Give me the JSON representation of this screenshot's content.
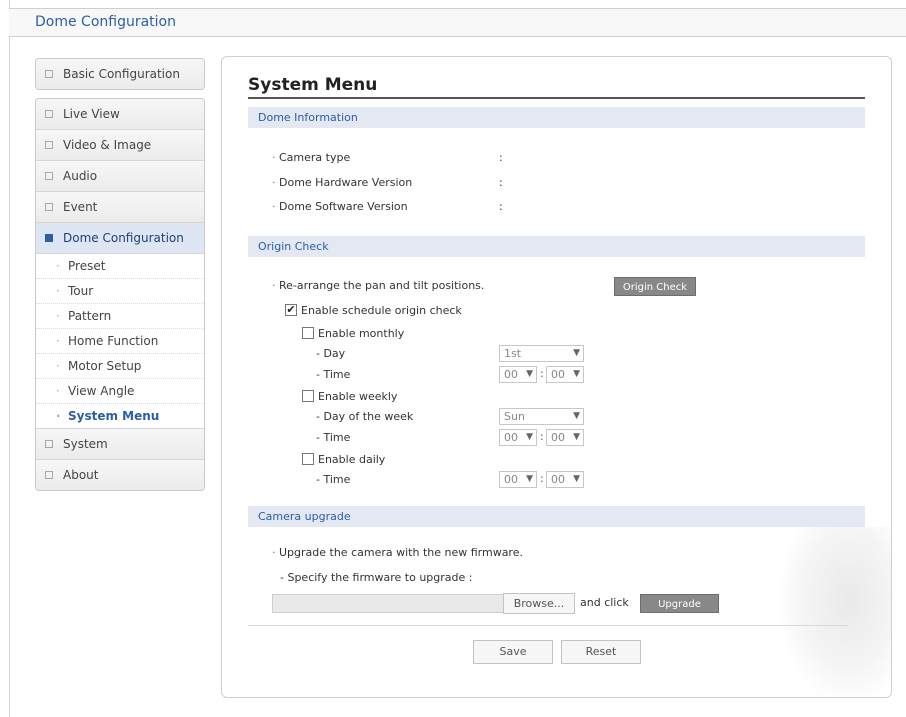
{
  "header": {
    "title": "Dome Configuration"
  },
  "sidebar": {
    "basic": {
      "label": "Basic Configuration"
    },
    "items": [
      {
        "label": "Live View"
      },
      {
        "label": "Video & Image"
      },
      {
        "label": "Audio"
      },
      {
        "label": "Event"
      },
      {
        "label": "Dome Configuration"
      }
    ],
    "sub_items": [
      {
        "label": "Preset"
      },
      {
        "label": "Tour"
      },
      {
        "label": "Pattern"
      },
      {
        "label": "Home Function"
      },
      {
        "label": "Motor Setup"
      },
      {
        "label": "View Angle"
      },
      {
        "label": "System Menu"
      }
    ],
    "after": [
      {
        "label": "System"
      },
      {
        "label": "About"
      }
    ]
  },
  "main": {
    "title": "System Menu",
    "dome_info": {
      "heading": "Dome Information",
      "rows": [
        {
          "label": "Camera type",
          "sep": ":"
        },
        {
          "label": "Dome Hardware Version",
          "sep": ":"
        },
        {
          "label": "Dome Software Version",
          "sep": ":"
        }
      ]
    },
    "origin": {
      "heading": "Origin Check",
      "rearrange": "Re-arrange the pan and tilt positions.",
      "button": "Origin Check",
      "enable_schedule": "Enable schedule origin check",
      "enable_monthly": "Enable monthly",
      "day_label": "- Day",
      "day_value": "1st",
      "time_label": "- Time",
      "enable_weekly": "Enable weekly",
      "dow_label": "- Day of the week",
      "dow_value": "Sun",
      "enable_daily": "Enable daily",
      "hour": "00",
      "minute": "00",
      "colon": ":"
    },
    "upgrade": {
      "heading": "Camera upgrade",
      "text": "Upgrade the camera with the new firmware.",
      "specify": "- Specify the firmware to upgrade :",
      "browse": "Browse...",
      "and_click": "and click",
      "upgrade_button": "Upgrade"
    },
    "footer": {
      "save": "Save",
      "reset": "Reset"
    }
  },
  "colors": {
    "accent": "#2b5ea5",
    "section_bg": "#e3e8f2",
    "button_gray": "#888888"
  },
  "icons": {
    "sidebar_collapsed": "plus-box-icon",
    "sidebar_expanded": "minus-box-icon",
    "dropdown": "chevron-down-icon"
  }
}
